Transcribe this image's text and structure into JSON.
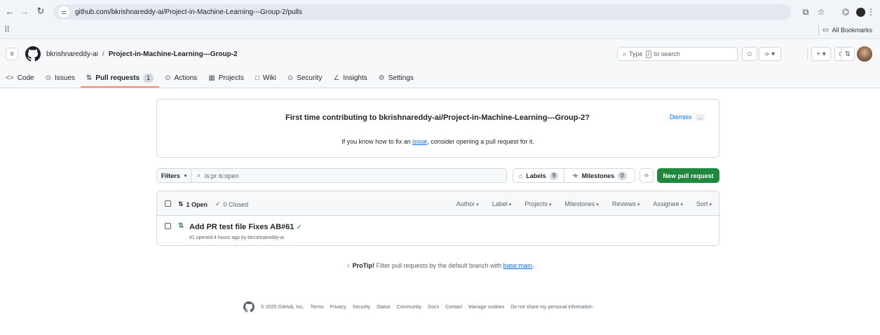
{
  "browser": {
    "url": "github.com/bkrishnareddy-ai/Project-in-Machine-Learning---Group-2/pulls",
    "all_bookmarks": "All Bookmarks"
  },
  "header": {
    "owner": "bkrishnareddy-ai",
    "separator": "/",
    "repo": "Project-in-Machine-Learning---Group-2",
    "search_prefix": "Type",
    "search_key": "/",
    "search_suffix": "to search"
  },
  "tabs": [
    {
      "label": "Code",
      "icon": "<>"
    },
    {
      "label": "Issues",
      "icon": "⊙"
    },
    {
      "label": "Pull requests",
      "icon": "⇅",
      "count": "1"
    },
    {
      "label": "Actions",
      "icon": "⊙"
    },
    {
      "label": "Projects",
      "icon": "▦"
    },
    {
      "label": "Wiki",
      "icon": "□"
    },
    {
      "label": "Security",
      "icon": "⊙"
    },
    {
      "label": "Insights",
      "icon": "∠"
    },
    {
      "label": "Settings",
      "icon": "⚙"
    }
  ],
  "banner": {
    "title": "First time contributing to bkrishnareddy-ai/Project-in-Machine-Learning---Group-2?",
    "sub_prefix": "If you know how to fix an",
    "sub_link": "issue",
    "sub_suffix": ", consider opening a pull request for it.",
    "dismiss": "Dismiss",
    "dots": "..."
  },
  "filters": {
    "filters_label": "Filters",
    "query": "is:pr is:open",
    "labels_label": "Labels",
    "labels_count": "9",
    "milestones_label": "Milestones",
    "milestones_count": "0",
    "new_pr_label": "New pull request"
  },
  "list": {
    "open_label": "1 Open",
    "closed_label": "0 Closed",
    "menus": [
      "Author",
      "Label",
      "Projects",
      "Milestones",
      "Reviews",
      "Assignee",
      "Sort"
    ],
    "prs": [
      {
        "title": "Add PR test file Fixes AB#61",
        "meta": "#1 opened 4 hours ago by bkrishnareddy-ai"
      }
    ]
  },
  "protip": {
    "bold": "ProTip!",
    "text": "Filter pull requests by the default branch with",
    "link": "base:main",
    "end": "."
  },
  "footer": {
    "links": [
      "© 2025 GitHub, Inc.",
      "Terms",
      "Privacy",
      "Security",
      "Status",
      "Community",
      "Docs",
      "Contact",
      "Manage cookies",
      "Do not share my personal information"
    ]
  }
}
